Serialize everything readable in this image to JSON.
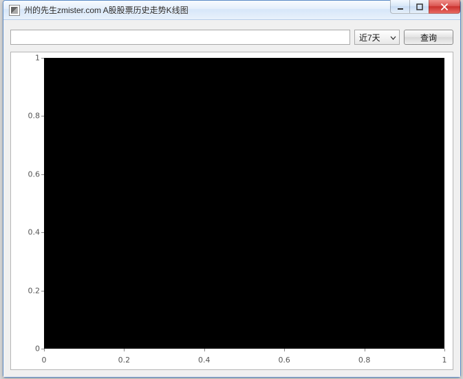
{
  "window": {
    "title": "州的先生zmister.com A股股票历史走势K线图"
  },
  "toolbar": {
    "search_value": "",
    "search_placeholder": "",
    "range_selected": "近7天",
    "query_label": "查询"
  },
  "chart_data": {
    "type": "line",
    "series": [],
    "xlim": [
      0,
      1
    ],
    "ylim": [
      0,
      1
    ],
    "x_ticks": [
      0,
      0.2,
      0.4,
      0.6,
      0.8,
      1
    ],
    "y_ticks": [
      0,
      0.2,
      0.4,
      0.6,
      0.8,
      1
    ],
    "x_tick_labels": [
      "0",
      "0.2",
      "0.4",
      "0.6",
      "0.8",
      "1"
    ],
    "y_tick_labels": [
      "0",
      "0.2",
      "0.4",
      "0.6",
      "0.8",
      "1"
    ],
    "title": "",
    "xlabel": "",
    "ylabel": "",
    "background": "#000000"
  },
  "colors": {
    "window_border": "#5a8ac6",
    "close_red": "#c9302c",
    "plot_bg": "#000000"
  }
}
